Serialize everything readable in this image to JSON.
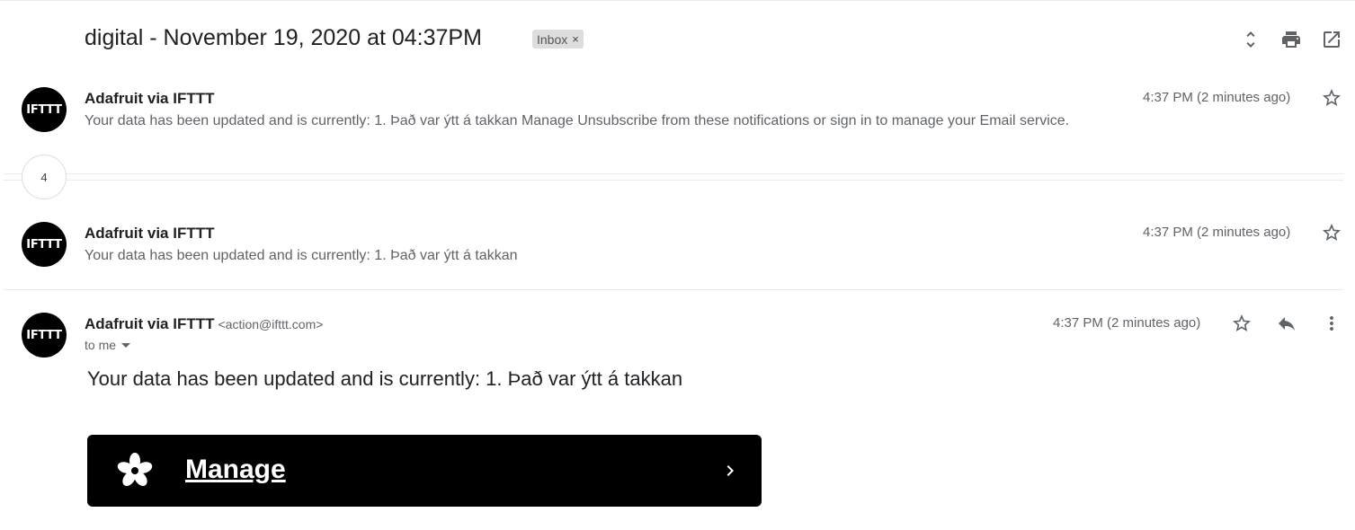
{
  "thread": {
    "subject": "digital - November 19, 2020 at 04:37PM",
    "label_chip": "Inbox",
    "label_remove": "×"
  },
  "header_icons": [
    "expand-collapse-icon",
    "print-icon",
    "open-in-new-window-icon"
  ],
  "messages": [
    {
      "avatar_text": "IFTTT",
      "sender": "Adafruit via IFTTT",
      "snippet": "Your data has been updated and is currently: 1. Það var ýtt á takkan Manage Unsubscribe from these notifications or sign in to manage your Email service.",
      "time": "4:37 PM (2 minutes ago)"
    },
    {
      "avatar_text": "IFTTT",
      "sender": "Adafruit via IFTTT",
      "snippet": "Your data has been updated and is currently: 1. Það var ýtt á takkan",
      "time": "4:37 PM (2 minutes ago)"
    }
  ],
  "collapsed_count": "4",
  "expanded": {
    "avatar_text": "IFTTT",
    "sender": "Adafruit via IFTTT",
    "sender_email": "<action@ifttt.com>",
    "recipient": "to me",
    "time": "4:37 PM (2 minutes ago)",
    "body": "Your data has been updated and is currently: 1. Það var ýtt á takkan",
    "manage_label": "Manage"
  },
  "colors": {
    "button_bg": "#000000",
    "icon_gray": "#5f6368",
    "chip_bg": "#dddddd"
  }
}
